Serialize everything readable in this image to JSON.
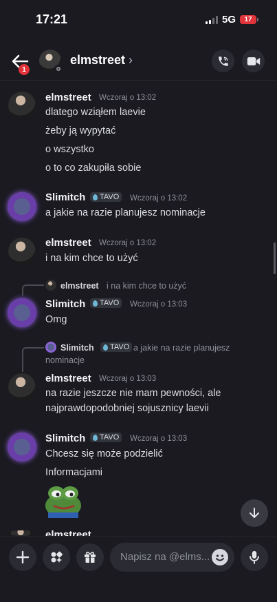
{
  "status_bar": {
    "time": "17:21",
    "network": "5G",
    "battery": "17"
  },
  "header": {
    "name": "elmstreet",
    "chevron": "›",
    "back_badge": "1"
  },
  "messages": [
    {
      "author": "elmstreet",
      "time": "Wczoraj o 13:02",
      "lines": [
        "dlatego wziąłem laevie",
        "żeby ją wypytać",
        "o wszystko",
        "o to co zakupiła sobie"
      ]
    },
    {
      "author": "Slimitch",
      "tag": "TAVO",
      "time": "Wczoraj o 13:02",
      "lines": [
        "a jakie na razie planujesz nominacje"
      ]
    },
    {
      "author": "elmstreet",
      "time": "Wczoraj o 13:02",
      "lines": [
        "i na kim chce to użyć"
      ]
    },
    {
      "reply_author": "elmstreet",
      "reply_text": "i na kim chce to użyć",
      "author": "Slimitch",
      "tag": "TAVO",
      "time": "Wczoraj o 13:03",
      "lines": [
        "Omg"
      ]
    },
    {
      "reply_author": "Slimitch",
      "reply_tag": "TAVO",
      "reply_text": "a jakie na razie planujesz",
      "reply_text2": "nominacje",
      "author": "elmstreet",
      "time": "Wczoraj o 13:03",
      "lines": [
        "na razie jeszcze nie mam pewności, ale",
        "najprawdopodobniej sojusznicy laevii"
      ]
    },
    {
      "author": "Slimitch",
      "tag": "TAVO",
      "time": "Wczoraj o 13:03",
      "lines": [
        "Chcesz się może podzielić",
        "Informacjami"
      ]
    }
  ],
  "partial_next_author": "elmstreet",
  "composer": {
    "placeholder": "Napisz na @elms..."
  },
  "colors": {
    "background": "#1a1a20",
    "accent_badge": "#e0343a",
    "tag_drop": "#6fb7d6"
  },
  "icons": [
    "back-arrow-icon",
    "phone-icon",
    "video-camera-icon",
    "plus-icon",
    "apps-icon",
    "gift-icon",
    "emoji-icon",
    "microphone-icon",
    "arrow-down-icon",
    "pepe-sticker"
  ]
}
